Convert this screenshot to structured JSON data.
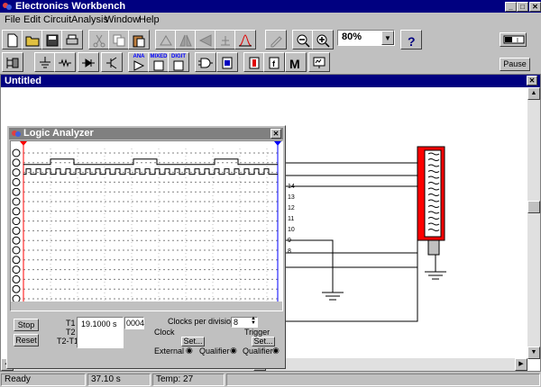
{
  "app": {
    "title": "Electronics Workbench"
  },
  "menu": [
    "File",
    "Edit",
    "Circuit",
    "Analysis",
    "Window",
    "Help"
  ],
  "toolbar": {
    "zoom_value": "80%",
    "pause_label": "Pause",
    "parts_labels": {
      "analog": "ANA",
      "mixed": "MIXED",
      "digital": "DIGIT"
    }
  },
  "document": {
    "title": "Untitled"
  },
  "circuit": {
    "pin_labels": [
      "14",
      "13",
      "12",
      "11",
      "10",
      "9",
      "8"
    ]
  },
  "logic_analyzer": {
    "title": "Logic Analyzer",
    "channels": 16,
    "stop_label": "Stop",
    "reset_label": "Reset",
    "t1_label": "T1",
    "t2_label": "T2",
    "t2t1_label": "T2-T1",
    "t1_value": "19.1000  s",
    "hex_value": "0004",
    "clocks_per_division_label": "Clocks per division",
    "clocks_per_division_value": "8",
    "clock_label": "Clock",
    "trigger_label": "Trigger",
    "clock_set_label": "Set...",
    "trigger_set_label": "Set...",
    "external_label": "External",
    "qualifier_label": "Qualifier",
    "trigger_qualifier_label": "Qualifier"
  },
  "status": {
    "state": "Ready",
    "time": "37.10 s",
    "temp": "Temp:  27"
  },
  "colors": {
    "title_active": "#000080",
    "title_inactive": "#808080",
    "ic_red": "#ff0000",
    "cursor_red": "#ff0000",
    "cursor_blue": "#0000ff"
  }
}
